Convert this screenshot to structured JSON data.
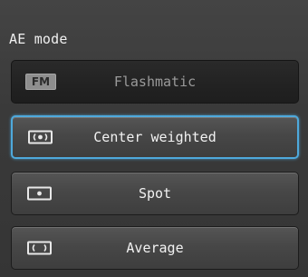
{
  "title": "AE mode",
  "options": [
    {
      "label": "Flashmatic",
      "icon": "fm-icon",
      "icon_text": "FM",
      "state": "disabled"
    },
    {
      "label": "Center weighted",
      "icon": "center-weighted-icon",
      "state": "selected"
    },
    {
      "label": "Spot",
      "icon": "spot-icon",
      "state": "normal"
    },
    {
      "label": "Average",
      "icon": "average-icon",
      "state": "normal"
    }
  ],
  "colors": {
    "selection": "#4ea9dc",
    "background": "#3b3b3b"
  }
}
